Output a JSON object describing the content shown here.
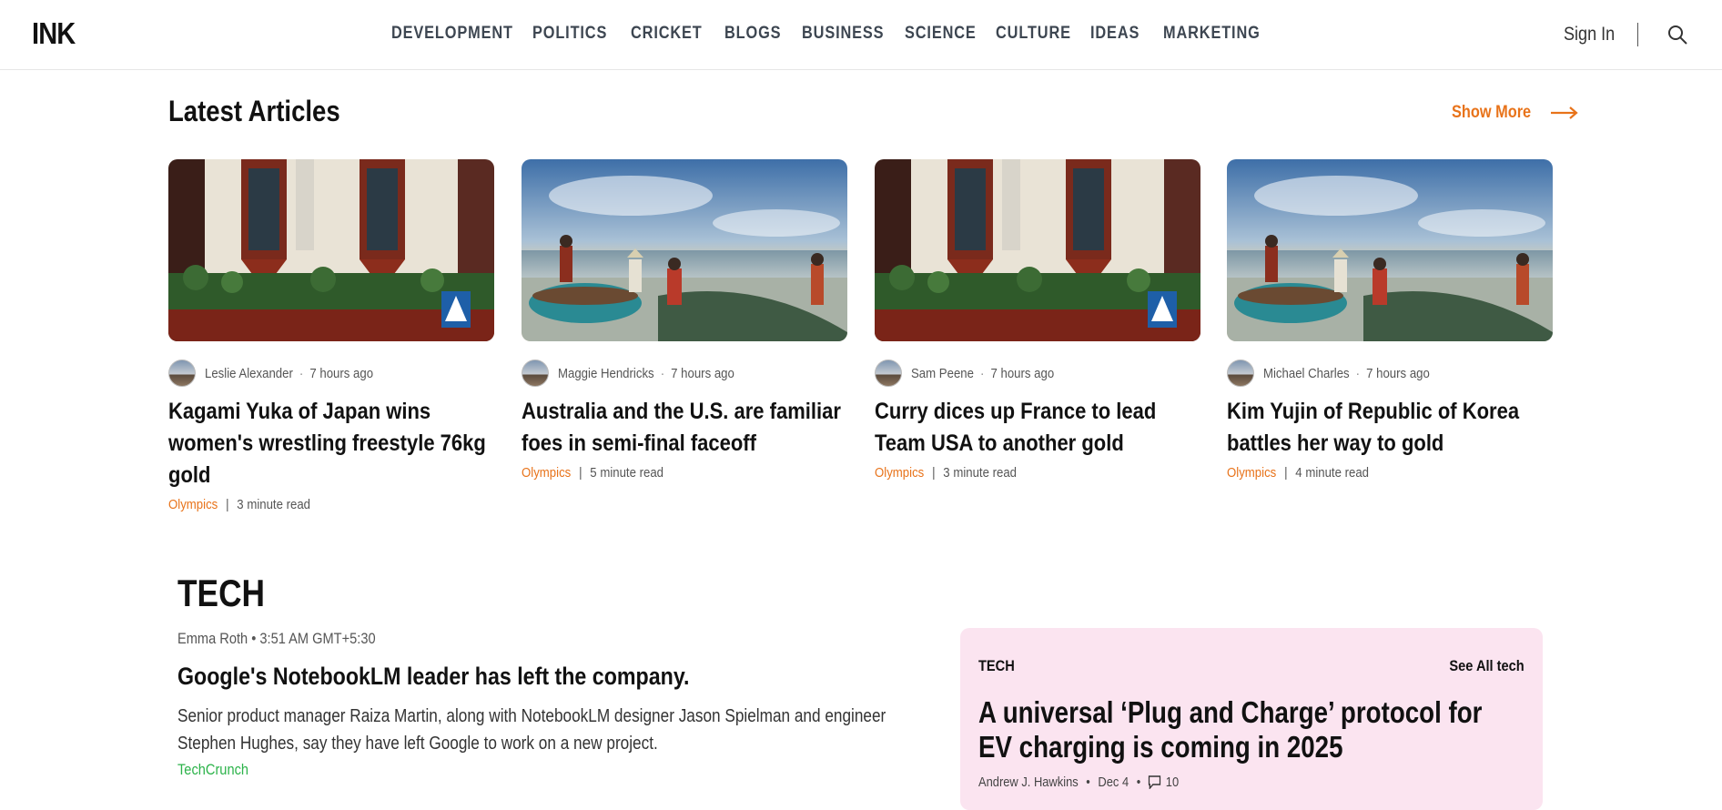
{
  "header": {
    "logo": "INK",
    "nav": [
      "DEVELOPMENT",
      "POLITICS",
      "CRICKET",
      "BLOGS",
      "BUSINESS",
      "SCIENCE",
      "CULTURE",
      "IDEAS",
      "MARKETING"
    ],
    "sign_in": "Sign In",
    "search_icon": "search-icon"
  },
  "latest": {
    "title": "Latest Articles",
    "show_more": "Show More",
    "show_more_icon": "arrow-right-icon",
    "accent_color": "#e8731a",
    "articles": [
      {
        "author": "Leslie Alexander",
        "time": "7 hours ago",
        "title": "Kagami Yuka of Japan wins women's wrestling freestyle 76kg gold",
        "tag": "Olympics",
        "read": "3 minute read",
        "image": "irish-pub-storefront"
      },
      {
        "author": "Maggie Hendricks",
        "time": "7 hours ago",
        "title": "Australia and the U.S. are familiar foes in semi-final faceoff",
        "tag": "Olympics",
        "read": "5 minute read",
        "image": "fishermen-on-beach"
      },
      {
        "author": "Sam Peene",
        "time": "7 hours ago",
        "title": "Curry dices up France to lead Team USA to another gold",
        "tag": "Olympics",
        "read": "3 minute read",
        "image": "irish-pub-storefront"
      },
      {
        "author": "Michael Charles",
        "time": "7 hours ago",
        "title": "Kim Yujin of Republic of Korea battles her way to gold",
        "tag": "Olympics",
        "read": "4 minute read",
        "image": "fishermen-on-beach"
      }
    ]
  },
  "tech": {
    "title": "TECH",
    "byline": "Emma Roth • 3:51 AM GMT+5:30",
    "headline": "Google's NotebookLM leader has left the company.",
    "summary": "Senior product manager Raiza Martin, along with NotebookLM designer Jason Spielman and engineer Stephen Hughes, say they have left Google to work on a new project.",
    "source": "TechCrunch",
    "source_color": "#2cb34a",
    "card": {
      "label": "TECH",
      "see_all": "See All tech",
      "title": "A universal ‘Plug and Charge’ protocol for EV charging is coming in 2025",
      "author": "Andrew J. Hawkins",
      "date": "Dec 4",
      "comments": "10",
      "background": "#fbe4f0"
    }
  }
}
